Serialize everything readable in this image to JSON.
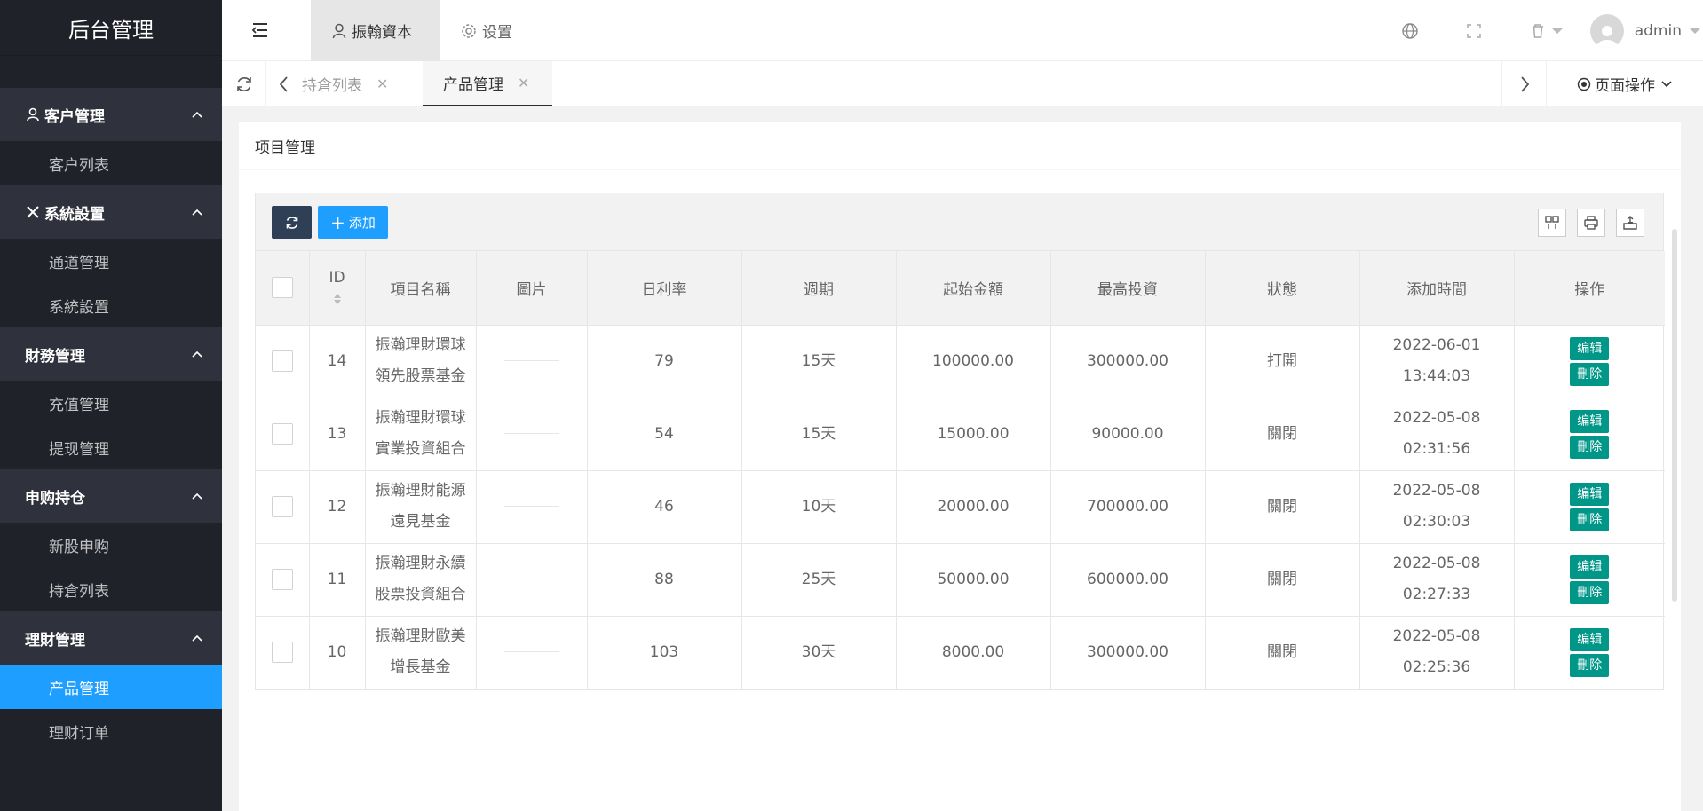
{
  "sidebar": {
    "logo": "后台管理",
    "groups": [
      {
        "title": "客户管理",
        "items": [
          "客户列表"
        ]
      },
      {
        "title": "系統設置",
        "items": [
          "通道管理",
          "系統設置"
        ]
      },
      {
        "title": "財務管理",
        "items": [
          "充值管理",
          "提现管理"
        ]
      },
      {
        "title": "申购持仓",
        "items": [
          "新股申购",
          "持倉列表"
        ]
      },
      {
        "title": "理財管理",
        "items": [
          "产品管理",
          "理财订单"
        ]
      }
    ]
  },
  "header": {
    "tab_active": "振翰資本",
    "tab_settings": "设置",
    "user": "admin"
  },
  "tabbar": {
    "tab1": "持倉列表",
    "tab2": "产品管理",
    "page_ops": "页面操作"
  },
  "card": {
    "title": "项目管理"
  },
  "toolbar": {
    "add_label": "添加"
  },
  "table": {
    "columns": [
      "ID",
      "項目名稱",
      "圖片",
      "日利率",
      "週期",
      "起始金額",
      "最高投資",
      "狀態",
      "添加時間",
      "操作"
    ],
    "edit_label": "编辑",
    "delete_label": "刪除",
    "rows": [
      {
        "id": "14",
        "name": "振瀚理財環球領先股票基金",
        "rate": "79",
        "period": "15天",
        "min": "100000.00",
        "max": "300000.00",
        "status": "打開",
        "date": "2022-06-01",
        "time": "13:44:03"
      },
      {
        "id": "13",
        "name": "振瀚理財環球實業投資組合",
        "rate": "54",
        "period": "15天",
        "min": "15000.00",
        "max": "90000.00",
        "status": "關閉",
        "date": "2022-05-08",
        "time": "02:31:56"
      },
      {
        "id": "12",
        "name": "振瀚理財能源遠見基金",
        "rate": "46",
        "period": "10天",
        "min": "20000.00",
        "max": "700000.00",
        "status": "關閉",
        "date": "2022-05-08",
        "time": "02:30:03"
      },
      {
        "id": "11",
        "name": "振瀚理財永續股票投資組合",
        "rate": "88",
        "period": "25天",
        "min": "50000.00",
        "max": "600000.00",
        "status": "關閉",
        "date": "2022-05-08",
        "time": "02:27:33"
      },
      {
        "id": "10",
        "name": "振瀚理財歐美增長基金",
        "rate": "103",
        "period": "30天",
        "min": "8000.00",
        "max": "300000.00",
        "status": "關閉",
        "date": "2022-05-08",
        "time": "02:25:36"
      }
    ]
  }
}
